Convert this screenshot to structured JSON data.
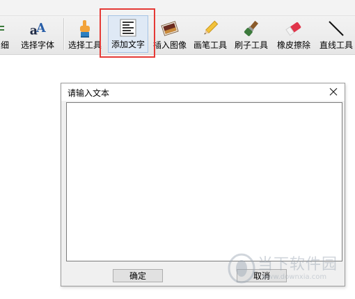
{
  "toolbar": {
    "items": [
      {
        "label": "细"
      },
      {
        "label": "选择字体"
      },
      {
        "label": "选择工具"
      },
      {
        "label": "添加文字"
      },
      {
        "label": "插入图像"
      },
      {
        "label": "画笔工具"
      },
      {
        "label": "刷子工具"
      },
      {
        "label": "橡皮擦除"
      },
      {
        "label": "直线工具"
      }
    ],
    "active_item": "添加文字",
    "highlight_color": "#e53935"
  },
  "dialog": {
    "title": "请输入文本",
    "text_value": "",
    "ok_label": "确定",
    "cancel_label": "取消"
  },
  "watermark": {
    "name": "当下软件园",
    "url": "www.downxia.com"
  }
}
